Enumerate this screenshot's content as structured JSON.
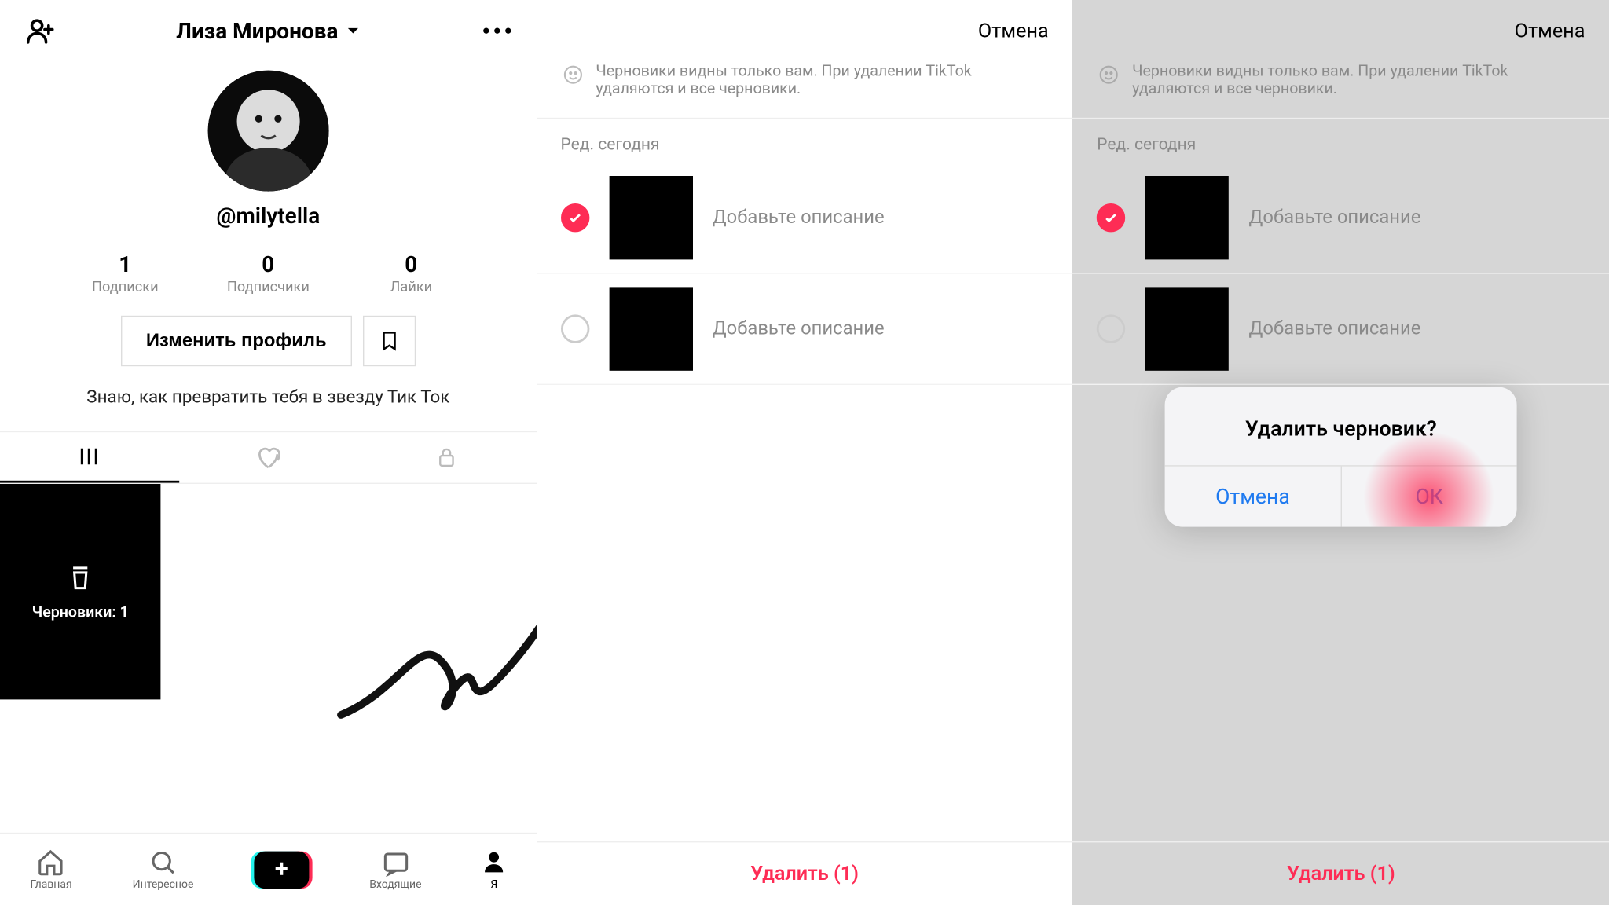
{
  "panel1": {
    "header": {
      "name": "Лиза Миронова"
    },
    "handle": "@milytella",
    "stats": [
      {
        "num": "1",
        "label": "Подписки"
      },
      {
        "num": "0",
        "label": "Подписчики"
      },
      {
        "num": "0",
        "label": "Лайки"
      }
    ],
    "edit_button": "Изменить профиль",
    "bio": "Знаю, как превратить тебя в звезду Тик Ток",
    "drafts_tile": "Черновики: 1",
    "nav": {
      "home": "Главная",
      "discover": "Интересное",
      "inbox": "Входящие",
      "me": "Я"
    }
  },
  "panel2": {
    "cancel": "Отмена",
    "hint": "Черновики видны только вам. При удалении TikTok удаляются и все черновики.",
    "section": "Ред. сегодня",
    "items": [
      {
        "desc": "Добавьте описание",
        "checked": true
      },
      {
        "desc": "Добавьте описание",
        "checked": false
      }
    ],
    "delete": "Удалить (1)"
  },
  "panel3": {
    "cancel": "Отмена",
    "hint": "Черновики видны только вам. При удалении TikTok удаляются и все черновики.",
    "section": "Ред. сегодня",
    "items": [
      {
        "desc": "Добавьте описание",
        "checked": true
      },
      {
        "desc": "Добавьте описание",
        "checked": false
      }
    ],
    "delete": "Удалить (1)",
    "modal": {
      "title": "Удалить черновик?",
      "cancel": "Отмена",
      "ok": "ОК"
    }
  }
}
